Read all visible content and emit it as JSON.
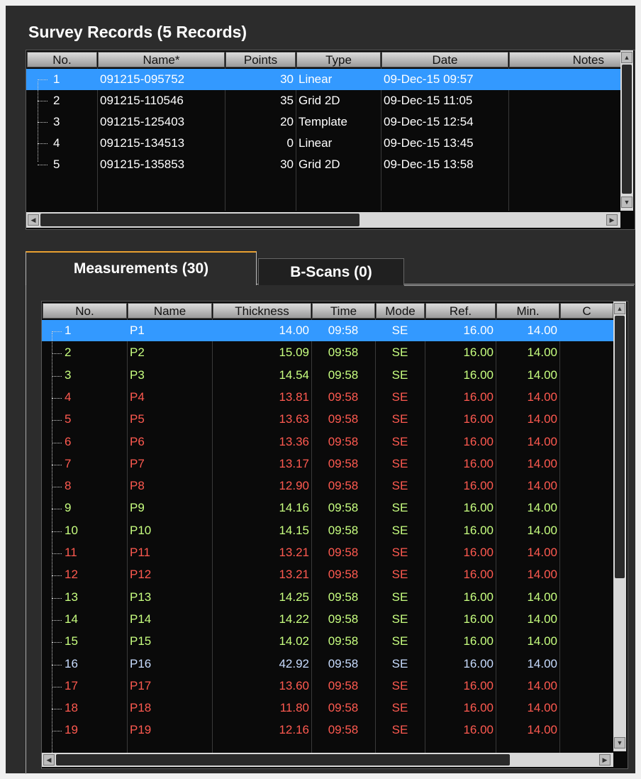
{
  "survey": {
    "title": "Survey Records (5 Records)",
    "columns": [
      "No.",
      "Name*",
      "Points",
      "Type",
      "Date",
      "Notes"
    ],
    "rows": [
      {
        "no": "1",
        "name": "091215-095752",
        "points": "30",
        "type": "Linear",
        "date": "09-Dec-15 09:57",
        "notes": "",
        "selected": true
      },
      {
        "no": "2",
        "name": "091215-110546",
        "points": "35",
        "type": "Grid 2D",
        "date": "09-Dec-15 11:05",
        "notes": "",
        "selected": false
      },
      {
        "no": "3",
        "name": "091215-125403",
        "points": "20",
        "type": "Template",
        "date": "09-Dec-15 12:54",
        "notes": "",
        "selected": false
      },
      {
        "no": "4",
        "name": "091215-134513",
        "points": "0",
        "type": "Linear",
        "date": "09-Dec-15 13:45",
        "notes": "",
        "selected": false
      },
      {
        "no": "5",
        "name": "091215-135853",
        "points": "30",
        "type": "Grid 2D",
        "date": "09-Dec-15 13:58",
        "notes": "",
        "selected": false
      }
    ]
  },
  "tabs": [
    {
      "label": "Measurements (30)",
      "active": true
    },
    {
      "label": "B-Scans (0)",
      "active": false
    }
  ],
  "measurements": {
    "columns": [
      "No.",
      "Name",
      "Thickness",
      "Time",
      "Mode",
      "Ref.",
      "Min.",
      "C"
    ],
    "colors": {
      "pass": "#c8ff80",
      "fail": "#ff5a50",
      "outlier": "#c8dcff",
      "selected": "#ffffff"
    },
    "rows": [
      {
        "no": "1",
        "name": "P1",
        "thickness": "14.00",
        "time": "09:58",
        "mode": "SE",
        "ref": "16.00",
        "min": "14.00",
        "status": "selected"
      },
      {
        "no": "2",
        "name": "P2",
        "thickness": "15.09",
        "time": "09:58",
        "mode": "SE",
        "ref": "16.00",
        "min": "14.00",
        "status": "pass"
      },
      {
        "no": "3",
        "name": "P3",
        "thickness": "14.54",
        "time": "09:58",
        "mode": "SE",
        "ref": "16.00",
        "min": "14.00",
        "status": "pass"
      },
      {
        "no": "4",
        "name": "P4",
        "thickness": "13.81",
        "time": "09:58",
        "mode": "SE",
        "ref": "16.00",
        "min": "14.00",
        "status": "fail"
      },
      {
        "no": "5",
        "name": "P5",
        "thickness": "13.63",
        "time": "09:58",
        "mode": "SE",
        "ref": "16.00",
        "min": "14.00",
        "status": "fail"
      },
      {
        "no": "6",
        "name": "P6",
        "thickness": "13.36",
        "time": "09:58",
        "mode": "SE",
        "ref": "16.00",
        "min": "14.00",
        "status": "fail"
      },
      {
        "no": "7",
        "name": "P7",
        "thickness": "13.17",
        "time": "09:58",
        "mode": "SE",
        "ref": "16.00",
        "min": "14.00",
        "status": "fail"
      },
      {
        "no": "8",
        "name": "P8",
        "thickness": "12.90",
        "time": "09:58",
        "mode": "SE",
        "ref": "16.00",
        "min": "14.00",
        "status": "fail"
      },
      {
        "no": "9",
        "name": "P9",
        "thickness": "14.16",
        "time": "09:58",
        "mode": "SE",
        "ref": "16.00",
        "min": "14.00",
        "status": "pass"
      },
      {
        "no": "10",
        "name": "P10",
        "thickness": "14.15",
        "time": "09:58",
        "mode": "SE",
        "ref": "16.00",
        "min": "14.00",
        "status": "pass"
      },
      {
        "no": "11",
        "name": "P11",
        "thickness": "13.21",
        "time": "09:58",
        "mode": "SE",
        "ref": "16.00",
        "min": "14.00",
        "status": "fail"
      },
      {
        "no": "12",
        "name": "P12",
        "thickness": "13.21",
        "time": "09:58",
        "mode": "SE",
        "ref": "16.00",
        "min": "14.00",
        "status": "fail"
      },
      {
        "no": "13",
        "name": "P13",
        "thickness": "14.25",
        "time": "09:58",
        "mode": "SE",
        "ref": "16.00",
        "min": "14.00",
        "status": "pass"
      },
      {
        "no": "14",
        "name": "P14",
        "thickness": "14.22",
        "time": "09:58",
        "mode": "SE",
        "ref": "16.00",
        "min": "14.00",
        "status": "pass"
      },
      {
        "no": "15",
        "name": "P15",
        "thickness": "14.02",
        "time": "09:58",
        "mode": "SE",
        "ref": "16.00",
        "min": "14.00",
        "status": "pass"
      },
      {
        "no": "16",
        "name": "P16",
        "thickness": "42.92",
        "time": "09:58",
        "mode": "SE",
        "ref": "16.00",
        "min": "14.00",
        "status": "outlier"
      },
      {
        "no": "17",
        "name": "P17",
        "thickness": "13.60",
        "time": "09:58",
        "mode": "SE",
        "ref": "16.00",
        "min": "14.00",
        "status": "fail"
      },
      {
        "no": "18",
        "name": "P18",
        "thickness": "11.80",
        "time": "09:58",
        "mode": "SE",
        "ref": "16.00",
        "min": "14.00",
        "status": "fail"
      },
      {
        "no": "19",
        "name": "P19",
        "thickness": "12.16",
        "time": "09:58",
        "mode": "SE",
        "ref": "16.00",
        "min": "14.00",
        "status": "fail"
      }
    ]
  }
}
